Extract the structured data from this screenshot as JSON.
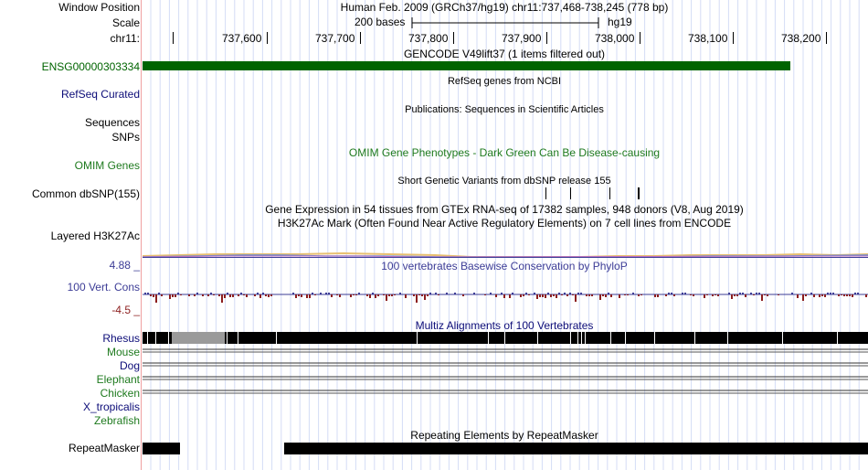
{
  "header": {
    "window_position_label": "Window Position",
    "scale_label": "Scale",
    "chrom_label": "chr11:",
    "assembly_title": "Human Feb. 2009 (GRCh37/hg19)   chr11:737,468-738,245 (778 bp)",
    "scale_text": "200 bases",
    "scale_db": "hg19",
    "ruler_ticks": [
      "737,600",
      "737,700",
      "737,800",
      "737,900",
      "738,000",
      "738,100",
      "738,200"
    ]
  },
  "tracks": {
    "gencode": {
      "title": "GENCODE V49lift37 (1 items filtered out)",
      "item_label": "ENSG00000303334",
      "color": "#006400"
    },
    "refseq": {
      "label": "RefSeq Curated",
      "title": "RefSeq genes from NCBI",
      "color": "#0c0c78"
    },
    "publications": {
      "label": "Sequences",
      "title": "Publications: Sequences in Scientific Articles"
    },
    "snps_pub": {
      "label": "SNPs"
    },
    "omim": {
      "label": "OMIM Genes",
      "title": "OMIM Gene Phenotypes - Dark Green Can Be Disease-causing",
      "color": "#1e7a1e"
    },
    "dbsnp": {
      "label": "Common dbSNP(155)",
      "title": "Short Genetic Variants from dbSNP release 155"
    },
    "gtex": {
      "title": "Gene Expression in 54 tissues from GTEx RNA-seq of 17382 samples, 948 donors (V8, Aug 2019)"
    },
    "h3k27ac": {
      "label": "Layered H3K27Ac",
      "title": "H3K27Ac Mark (Often Found Near Active Regulatory Elements) on 7 cell lines from ENCODE"
    },
    "conservation": {
      "max_label": "4.88 _",
      "label": "100 Vert. Cons",
      "min_label": "-4.5 _",
      "title": "100 vertebrates Basewise Conservation by PhyloP",
      "color": "#3c3c96",
      "neg_color": "#8c1e1e"
    },
    "multiz": {
      "title": "Multiz Alignments of 100 Vertebrates",
      "species": [
        {
          "name": "Rhesus",
          "color": "#0c0c78"
        },
        {
          "name": "Mouse",
          "color": "#1e7a1e"
        },
        {
          "name": "Dog",
          "color": "#0c0c78"
        },
        {
          "name": "Elephant",
          "color": "#1e7a1e"
        },
        {
          "name": "Chicken",
          "color": "#1e7a1e"
        },
        {
          "name": "X_tropicalis",
          "color": "#0c0c78"
        },
        {
          "name": "Zebrafish",
          "color": "#1e7a1e"
        }
      ]
    },
    "repeatmasker": {
      "label": "RepeatMasker",
      "title": "Repeating Elements by RepeatMasker"
    }
  }
}
